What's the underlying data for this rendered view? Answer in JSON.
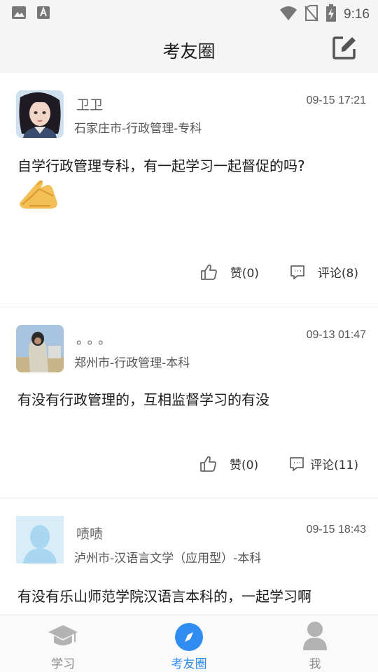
{
  "status_bar": {
    "time": "9:16",
    "left_icons": [
      "image-icon",
      "font-icon"
    ],
    "right_icons": [
      "wifi-icon",
      "no-sim-icon",
      "battery-charging-icon"
    ]
  },
  "header": {
    "title": "考友圈",
    "edit_icon": "edit-icon"
  },
  "posts": [
    {
      "username": "卫卫",
      "meta": "石家庄市-行政管理-专科",
      "time": "09-15 17:21",
      "content": "自学行政管理专科，有一起学习一起督促的吗?",
      "emoji": "🙏",
      "like_label": "赞(0)",
      "comment_label": "评论(8)"
    },
    {
      "username": "。。。",
      "meta": "郑州市-行政管理-本科",
      "time": "09-13 01:47",
      "content": "有没有行政管理的，互相监督学习的有没",
      "like_label": "赞(0)",
      "comment_label": "评论(11)"
    },
    {
      "username": "啧啧",
      "meta": "泸州市-汉语言文学（应用型）-本科",
      "time": "09-15 18:43",
      "content": "有没有乐山师范学院汉语言本科的，一起学习啊"
    }
  ],
  "bottom_nav": {
    "items": [
      {
        "label": "学习",
        "icon": "graduation-cap-icon"
      },
      {
        "label": "考友圈",
        "icon": "compass-icon"
      },
      {
        "label": "我",
        "icon": "user-icon"
      }
    ],
    "active_index": 1
  },
  "colors": {
    "accent": "#2f8cf0",
    "header_bg": "#f5f5f5",
    "icon_gray": "#6a6a6a"
  }
}
